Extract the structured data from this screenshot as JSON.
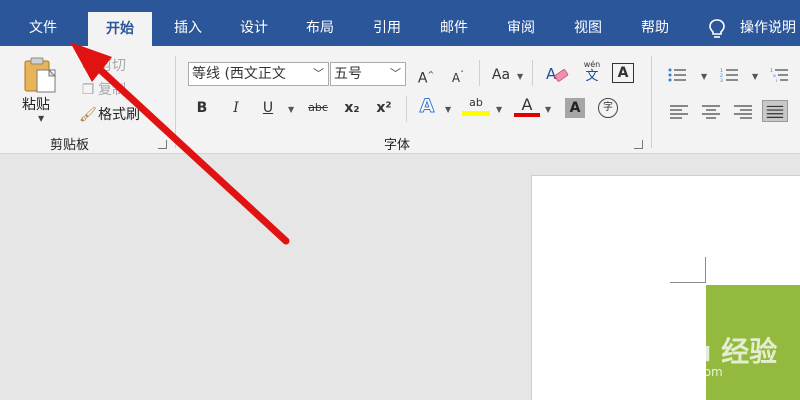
{
  "menu": {
    "tabs": [
      "文件",
      "开始",
      "插入",
      "设计",
      "布局",
      "引用",
      "邮件",
      "审阅",
      "视图",
      "帮助"
    ],
    "active_tab": "开始",
    "tell_me": "操作说明"
  },
  "clipboard": {
    "paste": "粘贴",
    "cut": "剪切",
    "copy": "复制",
    "format_painter": "格式刷",
    "group_label": "剪贴板"
  },
  "font": {
    "font_name": "等线 (西文正文",
    "font_size": "五号",
    "grow": "A",
    "shrink": "A",
    "change_case": "Aa",
    "phonetic": "wén",
    "phonetic_char": "文",
    "char_border": "A",
    "bold": "B",
    "italic": "I",
    "underline": "U",
    "strikethrough": "abc",
    "subscript": "x₂",
    "superscript": "x²",
    "text_effects": "A",
    "highlight": "ab",
    "font_color": "A",
    "char_shading": "A",
    "enclose": "字",
    "group_label": "字体"
  },
  "watermark": {
    "brand": "Bai du 经验",
    "url": "jingyan.baidu.com"
  },
  "colors": {
    "menubar": "#2b579a",
    "highlight": "#ffff00",
    "font_color": "#e00000",
    "arrow": "#e01212",
    "green_block": "#93b93f"
  }
}
